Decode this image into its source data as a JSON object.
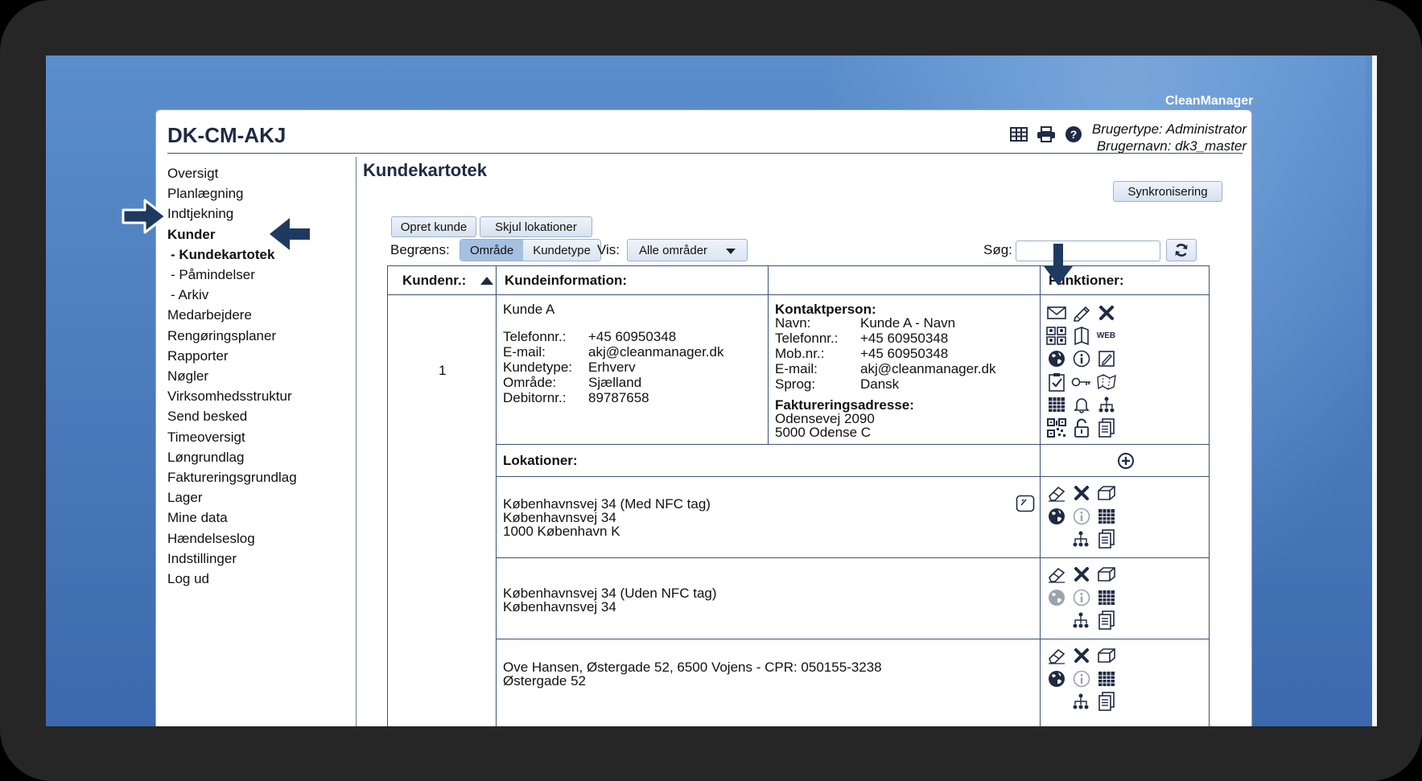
{
  "brand": "CleanManager",
  "system_name": "DK-CM-AKJ",
  "user": {
    "type": "Brugertype: Administrator",
    "name": "Brugernavn: dk3_master"
  },
  "top_icons": [
    "grid-icon",
    "print-icon",
    "help-icon"
  ],
  "nav": [
    {
      "label": "Oversigt",
      "bold": false
    },
    {
      "label": "Planlægning",
      "bold": false
    },
    {
      "label": "Indtjekning",
      "bold": false
    },
    {
      "label": "Kunder",
      "bold": true
    },
    {
      "label": "- Kundekartotek",
      "bold": true
    },
    {
      "label": "- Påmindelser",
      "bold": false
    },
    {
      "label": "- Arkiv",
      "bold": false
    },
    {
      "label": "Medarbejdere",
      "bold": false
    },
    {
      "label": "Rengøringsplaner",
      "bold": false
    },
    {
      "label": "Rapporter",
      "bold": false
    },
    {
      "label": "Nøgler",
      "bold": false
    },
    {
      "label": "Virksomhedsstruktur",
      "bold": false
    },
    {
      "label": "Send besked",
      "bold": false
    },
    {
      "label": "Timeoversigt",
      "bold": false
    },
    {
      "label": "Løngrundlag",
      "bold": false
    },
    {
      "label": "Faktureringsgrundlag",
      "bold": false
    },
    {
      "label": "Lager",
      "bold": false
    },
    {
      "label": "Mine data",
      "bold": false
    },
    {
      "label": "Hændelseslog",
      "bold": false
    },
    {
      "label": "Indstillinger",
      "bold": false
    },
    {
      "label": "Log ud",
      "bold": false
    }
  ],
  "page_title": "Kundekartotek",
  "buttons": {
    "sync": "Synkronisering",
    "create": "Opret kunde",
    "hide_locations": "Skjul lokationer"
  },
  "filter": {
    "limit_label": "Begræns:",
    "seg_area": "Område",
    "seg_type": "Kundetype",
    "view_label": "Vis:",
    "view_value": "Alle områder",
    "search_label": "Søg:",
    "search_value": ""
  },
  "table": {
    "headers": {
      "num": "Kundenr.:",
      "info": "Kundeinformation:",
      "func": "Funktioner:"
    },
    "customer": {
      "number": "1",
      "name": "Kunde A",
      "rows": [
        [
          "Telefonnr.:",
          "+45 60950348"
        ],
        [
          "E-mail:",
          "akj@cleanmanager.dk"
        ],
        [
          "Kundetype:",
          "Erhverv"
        ],
        [
          "Område:",
          "Sjælland"
        ],
        [
          "Debitornr.:",
          "89787658"
        ]
      ],
      "contact_title": "Kontaktperson:",
      "contact": [
        [
          "Navn:",
          "Kunde A - Navn"
        ],
        [
          "Telefonnr.:",
          "+45 60950348"
        ],
        [
          "Mob.nr.:",
          "+45 60950348"
        ],
        [
          "E-mail:",
          "akj@cleanmanager.dk"
        ],
        [
          "Sprog:",
          "Dansk"
        ]
      ],
      "billing_title": "Faktureringsadresse:",
      "billing": [
        "Odensevej 2090",
        "5000 Odense C"
      ]
    },
    "locations_title": "Lokationer:",
    "locations": [
      {
        "lines": [
          "Københavnsvej 34 (Med NFC tag)",
          "Københavnsvej 34",
          "1000 København K"
        ]
      },
      {
        "lines": [
          "Københavnsvej 34 (Uden NFC tag)",
          "Københavnsvej 34"
        ]
      },
      {
        "lines": [
          "Ove Hansen, Østergade 52, 6500 Vojens - CPR: 050155-3238",
          "Østergade 52"
        ]
      }
    ]
  },
  "customer_icons": [
    "envelope-icon",
    "pencil-icon",
    "delete-icon",
    "groups-icon",
    "book-icon",
    "web-icon",
    "globe-icon",
    "info-icon",
    "edit-note-icon",
    "checklist-icon",
    "key-icon",
    "map-icon",
    "calendar-icon",
    "bell-icon",
    "hierarchy-icon",
    "qr-icon",
    "unlock-icon",
    "document-icon"
  ],
  "web_label": "WEB"
}
